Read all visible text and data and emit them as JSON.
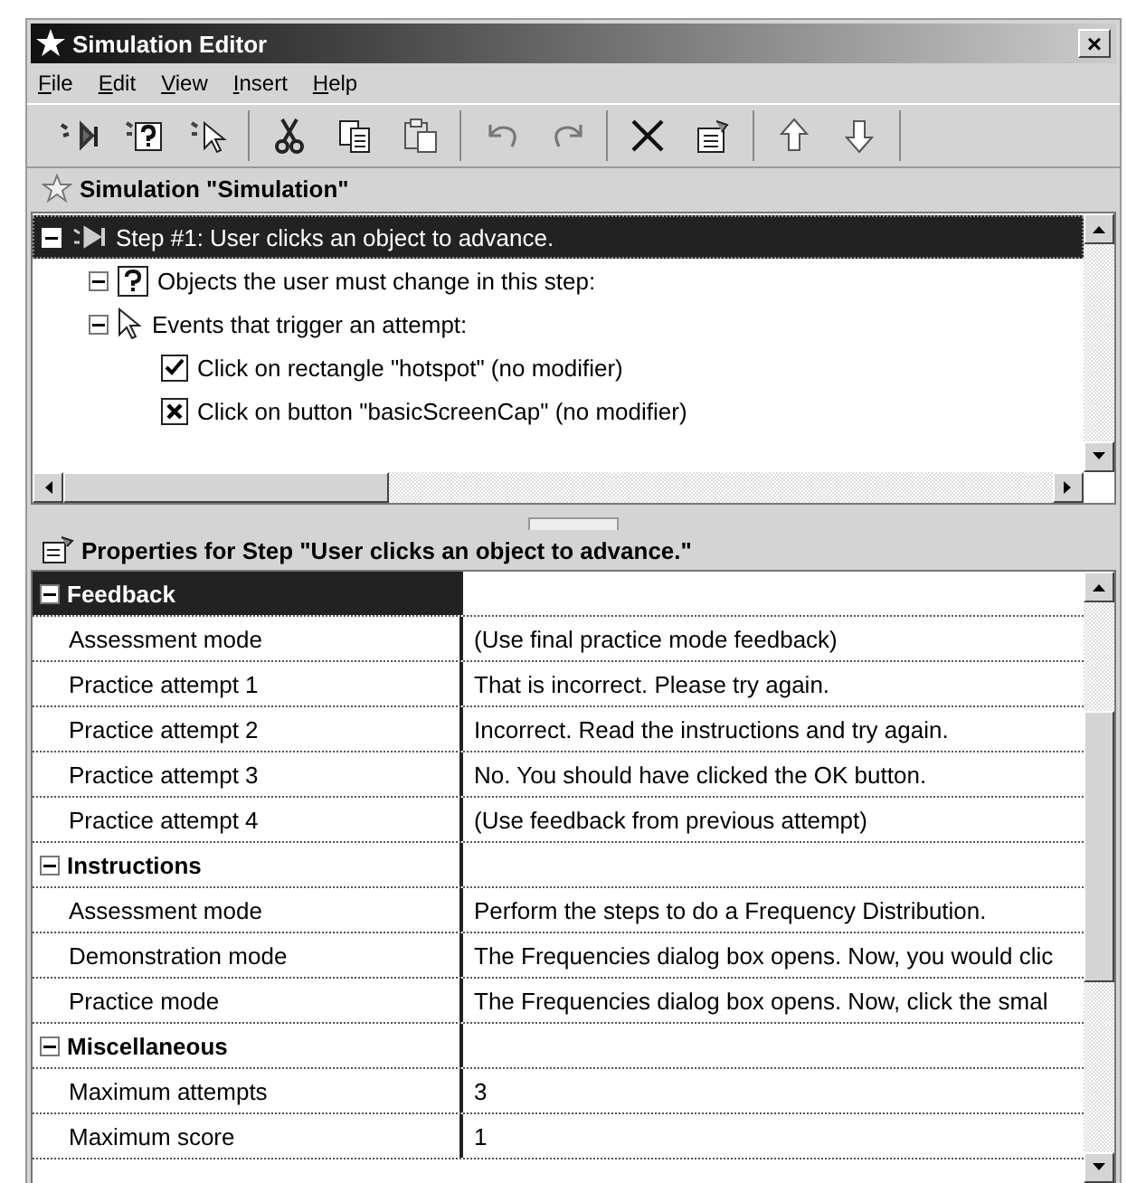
{
  "window": {
    "title": "Simulation Editor",
    "close": "×"
  },
  "menu": [
    "File",
    "Edit",
    "View",
    "Insert",
    "Help"
  ],
  "toolbar": [
    [
      {
        "kind": "step-insert"
      },
      {
        "kind": "question-insert"
      },
      {
        "kind": "event-insert"
      }
    ],
    [
      {
        "kind": "cut"
      },
      {
        "kind": "copy"
      },
      {
        "kind": "paste"
      }
    ],
    [
      {
        "kind": "undo"
      },
      {
        "kind": "redo"
      }
    ],
    [
      {
        "kind": "delete"
      },
      {
        "kind": "properties"
      }
    ],
    [
      {
        "kind": "move-up"
      },
      {
        "kind": "move-down"
      }
    ]
  ],
  "simulation": {
    "title": "Simulation \"Simulation\""
  },
  "tree": [
    {
      "label": "Step #1: User clicks an object to advance.",
      "kind": "step",
      "selected": true,
      "expanded": true,
      "children": [
        {
          "label": "Objects the user must change in this step:",
          "kind": "objects",
          "selected": false,
          "expanded": true
        },
        {
          "label": "Events that trigger an attempt:",
          "kind": "events",
          "selected": false,
          "expanded": true,
          "children": [
            {
              "label": "Click on rectangle \"hotspot\" (no modifier)",
              "kind": "check",
              "selected": false
            },
            {
              "label": "Click on button \"basicScreenCap\" (no modifier)",
              "kind": "cross",
              "selected": false
            }
          ]
        }
      ]
    }
  ],
  "properties": {
    "title": "Properties for Step \"User clicks an object to advance.\"",
    "categories": [
      {
        "name": "Feedback",
        "selected": true,
        "expanded": true,
        "rows": [
          {
            "name": "Assessment mode",
            "value": "(Use final practice mode feedback)"
          },
          {
            "name": "Practice attempt 1",
            "value": "That is incorrect. Please try again."
          },
          {
            "name": "Practice attempt 2",
            "value": "Incorrect. Read the instructions and try again."
          },
          {
            "name": "Practice attempt 3",
            "value": "No. You should have clicked the OK button."
          },
          {
            "name": "Practice attempt 4",
            "value": "(Use feedback from previous attempt)"
          }
        ]
      },
      {
        "name": "Instructions",
        "selected": false,
        "expanded": true,
        "rows": [
          {
            "name": "Assessment mode",
            "value": "Perform the steps to do a Frequency Distribution."
          },
          {
            "name": "Demonstration mode",
            "value": "The Frequencies dialog box opens. Now, you would clic"
          },
          {
            "name": "Practice mode",
            "value": "The Frequencies dialog box opens. Now, click the smal"
          }
        ]
      },
      {
        "name": "Miscellaneous",
        "selected": false,
        "expanded": true,
        "rows": [
          {
            "name": "Maximum attempts",
            "value": "3"
          },
          {
            "name": "Maximum score",
            "value": "1"
          }
        ]
      }
    ]
  }
}
